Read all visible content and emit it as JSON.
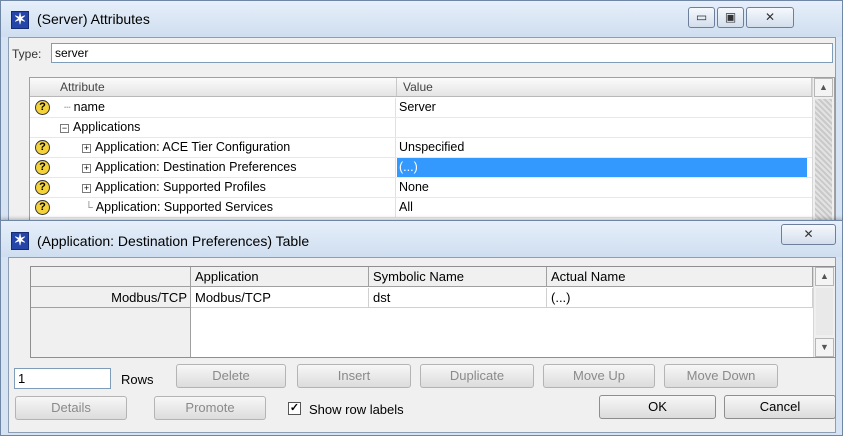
{
  "outer_window": {
    "title": "(Server) Attributes",
    "icon": "opnet-app-icon",
    "type_label": "Type:",
    "type_value": "server",
    "columns": [
      "Attribute",
      "Value"
    ],
    "rows": [
      {
        "attribute": "name",
        "value": "Server",
        "help": true,
        "kind": "leaf"
      },
      {
        "attribute": "Applications",
        "value": "",
        "help": false,
        "kind": "expanded"
      },
      {
        "attribute": "Application: ACE Tier Configuration",
        "value": "Unspecified",
        "help": true,
        "kind": "collapsed"
      },
      {
        "attribute": "Application: Destination Preferences",
        "value": "(...)",
        "help": true,
        "kind": "collapsed",
        "selected": true
      },
      {
        "attribute": "Application: Supported Profiles",
        "value": "None",
        "help": true,
        "kind": "collapsed"
      },
      {
        "attribute": "Application: Supported Services",
        "value": "All",
        "help": true,
        "kind": "leaf-last"
      }
    ]
  },
  "inner_window": {
    "title": "(Application: Destination Preferences) Table",
    "columns": [
      "Application",
      "Symbolic Name",
      "Actual Name"
    ],
    "rows": [
      {
        "label": "Modbus/TCP",
        "application": "Modbus/TCP",
        "symbolic_name": "dst",
        "actual_name": "(...)"
      }
    ],
    "rows_count": "1",
    "rows_label": "Rows",
    "buttons": {
      "delete": "Delete",
      "insert": "Insert",
      "duplicate": "Duplicate",
      "move_up": "Move Up",
      "move_down": "Move Down",
      "details": "Details",
      "promote": "Promote",
      "ok": "OK",
      "cancel": "Cancel"
    },
    "show_row_labels": {
      "label": "Show row labels",
      "checked": true
    }
  },
  "colors": {
    "selection": "#3399ff",
    "title_bar": "#d6e3f2",
    "help_icon": "#f4d23a"
  }
}
